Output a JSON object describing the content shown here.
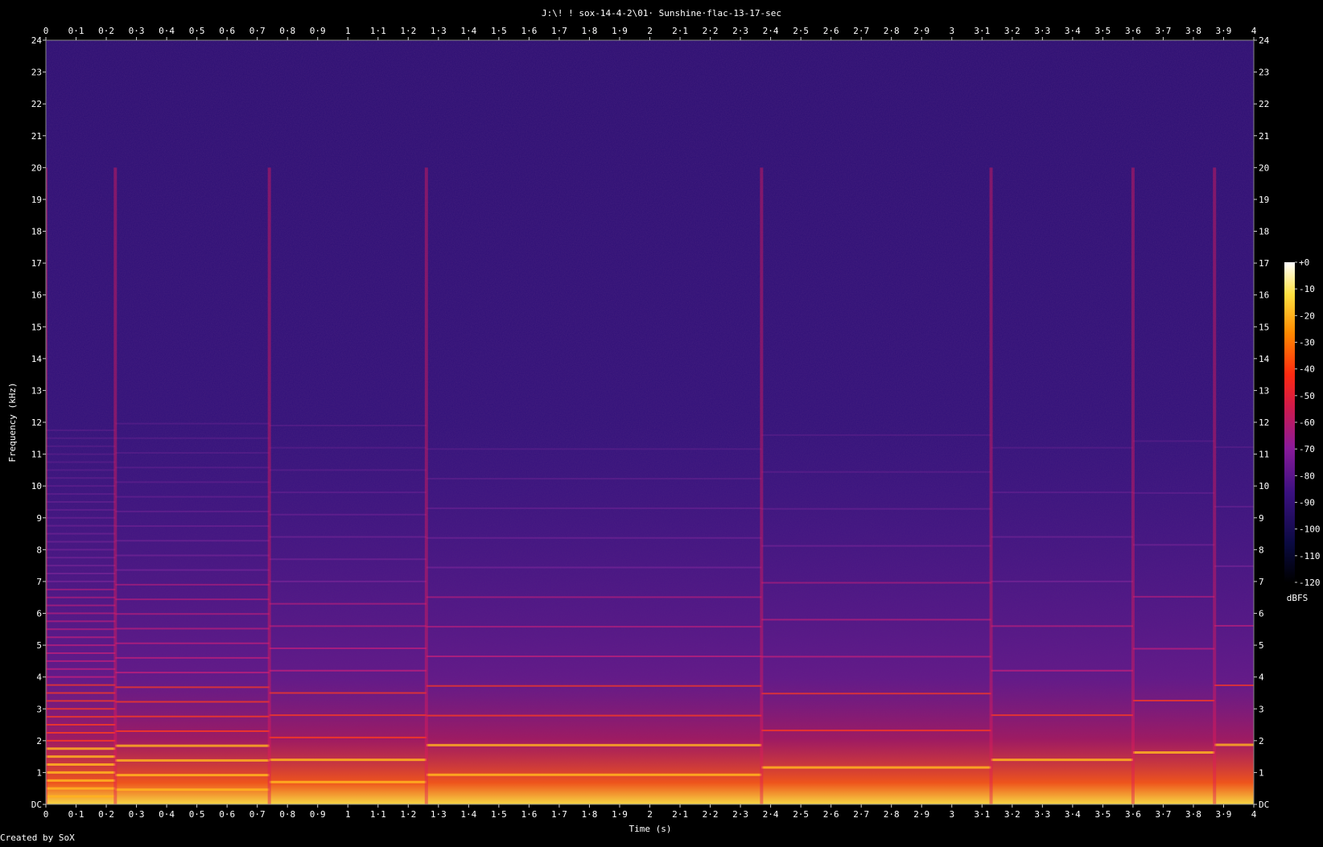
{
  "chart_data": {
    "type": "heatmap",
    "title": "J:\\! ! sox-14-4-2\\01· Sunshine·flac-13-17-sec",
    "xlabel": "Time (s)",
    "ylabel": "Frequency (kHz)",
    "footer": "Created by SoX",
    "xlim": [
      0,
      4
    ],
    "ylim": [
      0,
      24
    ],
    "x_ticks": [
      "0",
      "0·1",
      "0·2",
      "0·3",
      "0·4",
      "0·5",
      "0·6",
      "0·7",
      "0·8",
      "0·9",
      "1",
      "1·1",
      "1·2",
      "1·3",
      "1·4",
      "1·5",
      "1·6",
      "1·7",
      "1·8",
      "1·9",
      "2",
      "2·1",
      "2·2",
      "2·3",
      "2·4",
      "2·5",
      "2·6",
      "2·7",
      "2·8",
      "2·9",
      "3",
      "3·1",
      "3·2",
      "3·3",
      "3·4",
      "3·5",
      "3·6",
      "3·7",
      "3·8",
      "3·9",
      "4"
    ],
    "y_ticks": [
      "DC",
      "1",
      "2",
      "3",
      "4",
      "5",
      "6",
      "7",
      "8",
      "9",
      "10",
      "11",
      "12",
      "13",
      "14",
      "15",
      "16",
      "17",
      "18",
      "19",
      "20",
      "21",
      "22",
      "23",
      "24"
    ],
    "colorbar": {
      "label": "dBFS",
      "ticks": [
        "+0",
        "-10",
        "-20",
        "-30",
        "-40",
        "-50",
        "-60",
        "-70",
        "-80",
        "-90",
        "-100",
        "-110",
        "-120"
      ],
      "range": [
        -120,
        0
      ]
    },
    "colormap": [
      "#000000",
      "#1a0a4a",
      "#3a1080",
      "#6a1aa0",
      "#a8187a",
      "#e01a38",
      "#ff4400",
      "#ff9a00",
      "#ffe040",
      "#ffffff"
    ],
    "note_onsets_s": [
      0.0,
      0.23,
      0.74,
      1.26,
      2.37,
      3.13,
      3.6,
      3.87
    ],
    "harmonic_fundamentals_khz": [
      0.25,
      0.46,
      0.7,
      0.93,
      1.16,
      1.4,
      1.63,
      1.87,
      2.1,
      2.34
    ]
  }
}
